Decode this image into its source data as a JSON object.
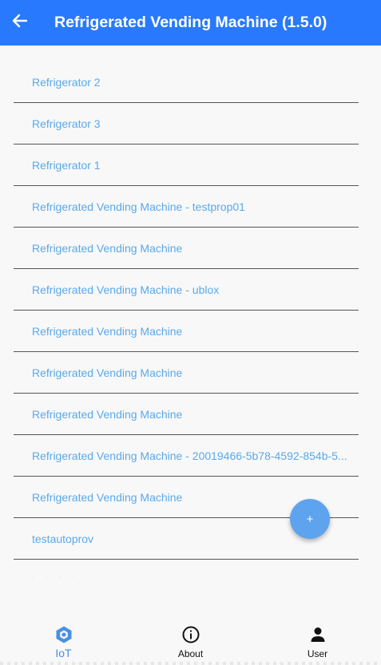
{
  "header": {
    "title": "Refrigerated Vending Machine (1.5.0)",
    "back_icon": "arrow-left-icon",
    "background_color": "#2979ff"
  },
  "list": {
    "items": [
      {
        "label": "Refrigerator 2"
      },
      {
        "label": "Refrigerator 3"
      },
      {
        "label": "Refrigerator 1"
      },
      {
        "label": "Refrigerated Vending Machine - testprop01"
      },
      {
        "label": "Refrigerated Vending Machine"
      },
      {
        "label": "Refrigerated Vending Machine - ublox"
      },
      {
        "label": "Refrigerated Vending Machine"
      },
      {
        "label": "Refrigerated Vending Machine"
      },
      {
        "label": "Refrigerated Vending Machine"
      },
      {
        "label": "Refrigerated Vending Machine - 20019466-5b78-4592-854b-5..."
      },
      {
        "label": "Refrigerated Vending Machine"
      },
      {
        "label": "testautoprov"
      }
    ],
    "partial_item_label": "· · · ·",
    "text_color": "#5aa9ea"
  },
  "fab": {
    "label": "+",
    "color": "#5ea3ee"
  },
  "bottom_nav": {
    "items": [
      {
        "label": "IoT",
        "icon": "hexagon-icon",
        "active": true
      },
      {
        "label": "About",
        "icon": "info-icon",
        "active": false
      },
      {
        "label": "User",
        "icon": "person-icon",
        "active": false
      }
    ],
    "active_color": "#4a90e2"
  }
}
